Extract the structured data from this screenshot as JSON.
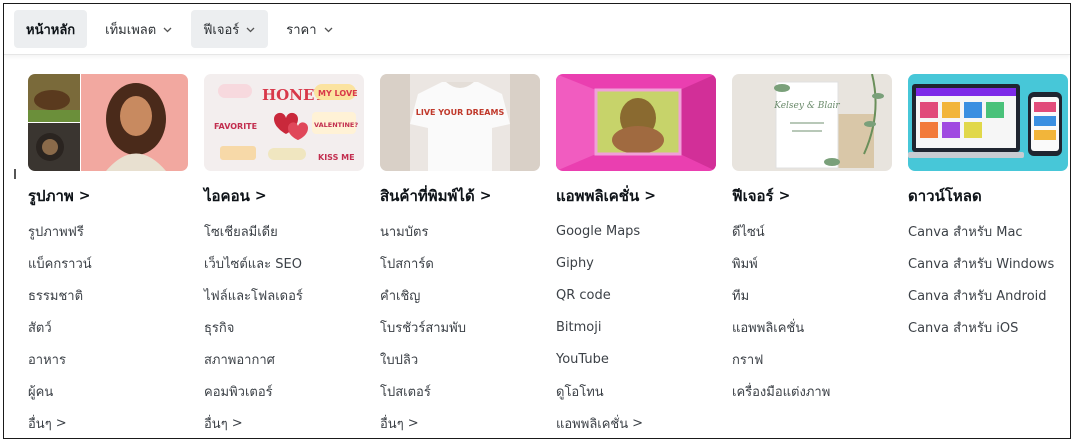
{
  "nav": {
    "items": [
      {
        "label": "หน้าหลัก",
        "has_dropdown": false
      },
      {
        "label": "เท็มเพลต",
        "has_dropdown": true
      },
      {
        "label": "ฟีเจอร์",
        "has_dropdown": true
      },
      {
        "label": "ราคา",
        "has_dropdown": true
      }
    ]
  },
  "menu": {
    "columns": [
      {
        "title": "รูปภาพ",
        "links": [
          "รูปภาพฟรี",
          "แบ็คกราวน์",
          "ธรรมชาติ",
          "สัตว์",
          "อาหาร",
          "ผู้คน",
          "อื่นๆ"
        ]
      },
      {
        "title": "ไอคอน",
        "links": [
          "โซเชียลมีเดีย",
          "เว็บไซต์และ SEO",
          "ไฟล์และโฟลเดอร์",
          "ธุรกิจ",
          "สภาพอากาศ",
          "คอมพิวเตอร์",
          "อื่นๆ"
        ]
      },
      {
        "title": "สินค้าที่พิมพ์ได้",
        "links": [
          "นามบัตร",
          "โปสการ์ด",
          "คำเชิญ",
          "โบรชัวร์สามพับ",
          "ใบปลิว",
          "โปสเตอร์",
          "อื่นๆ"
        ]
      },
      {
        "title": "แอพพลิเคชั่น",
        "links": [
          "Google Maps",
          "Giphy",
          "QR code",
          "Bitmoji",
          "YouTube",
          "ดูโอโทน",
          "แอพพลิเคชั่น"
        ]
      },
      {
        "title": "ฟีเจอร์",
        "links": [
          "ดีไซน์",
          "พิมพ์",
          "ทีม",
          "แอพพลิเคชั่น",
          "กราฟ",
          "เครื่องมือแต่งภาพ"
        ]
      },
      {
        "title": "ดาวน์โหลด",
        "links": [
          "Canva สำหรับ Mac",
          "Canva สำหรับ Windows",
          "Canva สำหรับ Android",
          "Canva สำหรับ iOS"
        ]
      }
    ],
    "thumb_texts": {
      "icons_honey": "HONEY",
      "icons_my_love": "MY LOVE",
      "icons_favorite": "FAVORITE",
      "icons_valentine": "VALENTINE?",
      "icons_kiss_me": "KISS ME",
      "tshirt_text": "LIVE YOUR DREAMS",
      "invite_script": "Kelsey & Blair"
    }
  },
  "colors": {
    "active_bg": "#eceef0",
    "text_primary": "#0e1318",
    "text_secondary": "#3c4147",
    "border": "#1a1a1a",
    "pink_app": "#ea3fb0",
    "download_bg": "#47c7d8"
  },
  "icons": {
    "dropdown": "chevron-down-icon",
    "arrow": "chevron-right-icon"
  }
}
